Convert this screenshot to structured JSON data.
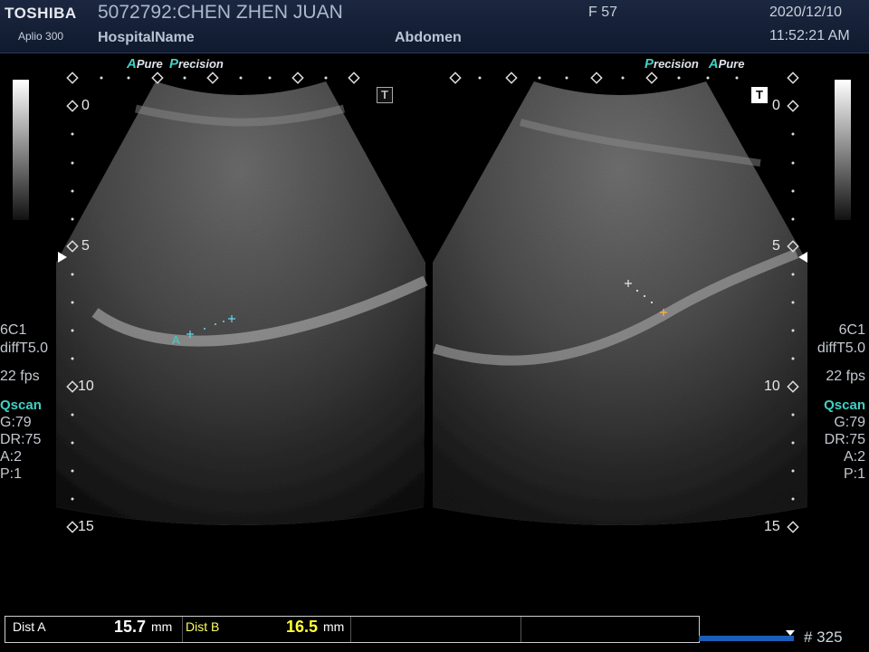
{
  "header": {
    "brand": "TOSHIBA",
    "model": "Aplio 300",
    "patient": "5072792:CHEN ZHEN JUAN",
    "hospital": "HospitalName",
    "sex_age": "F  57",
    "exam": "Abdomen",
    "date": "2020/12/10",
    "time": "11:52:21 AM"
  },
  "left_panel": {
    "apure": "A",
    "apure_text": "Pure",
    "precision_p": "P",
    "precision_text": "recision",
    "depth_labels": [
      "0",
      "5",
      "10",
      "15"
    ],
    "info": [
      "6C1",
      "diffT5.0",
      "22 fps"
    ],
    "qscan_q": "Q",
    "qscan_text": "scan",
    "params": [
      "G:79",
      "DR:75",
      "A:2",
      "P:1"
    ],
    "marker_label": "A",
    "tbox": "T"
  },
  "right_panel": {
    "precision_p": "P",
    "precision_text": "recision",
    "apure": "A",
    "apure_text": "Pure",
    "depth_labels": [
      "0",
      "5",
      "10",
      "15"
    ],
    "info": [
      "6C1",
      "diffT5.0",
      "22 fps"
    ],
    "qscan_q": "Q",
    "qscan_text": "scan",
    "params": [
      "G:79",
      "DR:75",
      "A:2",
      "P:1"
    ],
    "tbox": "T"
  },
  "measurements": {
    "a_label": "Dist A",
    "a_value": "15.7",
    "a_unit": "mm",
    "b_label": "Dist B",
    "b_value": "16.5",
    "b_unit": "mm"
  },
  "footer": {
    "frame": "# 325"
  },
  "colors": {
    "accent_cyan": "#3fd1c4",
    "b_value_yellow": "#ffff33",
    "cine_blue": "#1b5eb8"
  }
}
